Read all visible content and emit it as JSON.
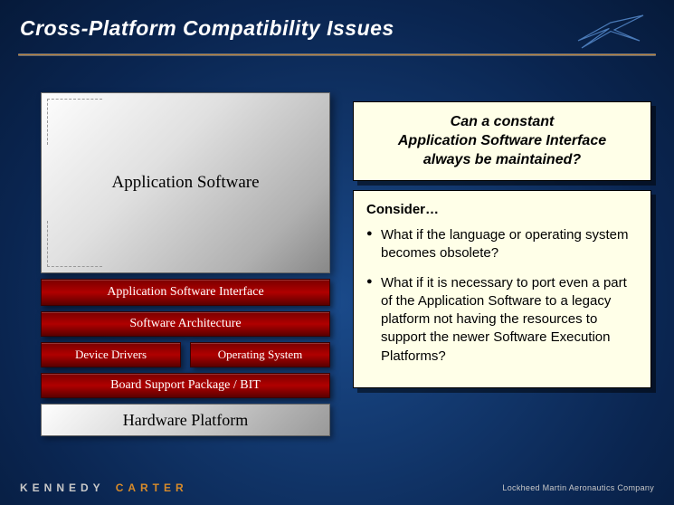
{
  "title": "Cross-Platform Compatibility Issues",
  "stack": {
    "app_sw": "Application Software",
    "asi": "Application Software Interface",
    "sa": "Software Architecture",
    "dd": "Device Drivers",
    "os": "Operating System",
    "bsp": "Board Support Package / BIT",
    "hw": "Hardware Platform"
  },
  "question": {
    "line1": "Can a constant",
    "line2": "Application Software Interface",
    "line3": "always be maintained?"
  },
  "consider": {
    "heading": "Consider…",
    "b1": "What if the language or operating system becomes obsolete?",
    "b2": "What if it is necessary to port even a part of the Application Software to a legacy platform not having the resources to support the newer Software Execution Platforms?"
  },
  "footer": {
    "kennedy": "KENNEDY",
    "carter": "CARTER",
    "lm": "Lockheed Martin Aeronautics Company"
  }
}
